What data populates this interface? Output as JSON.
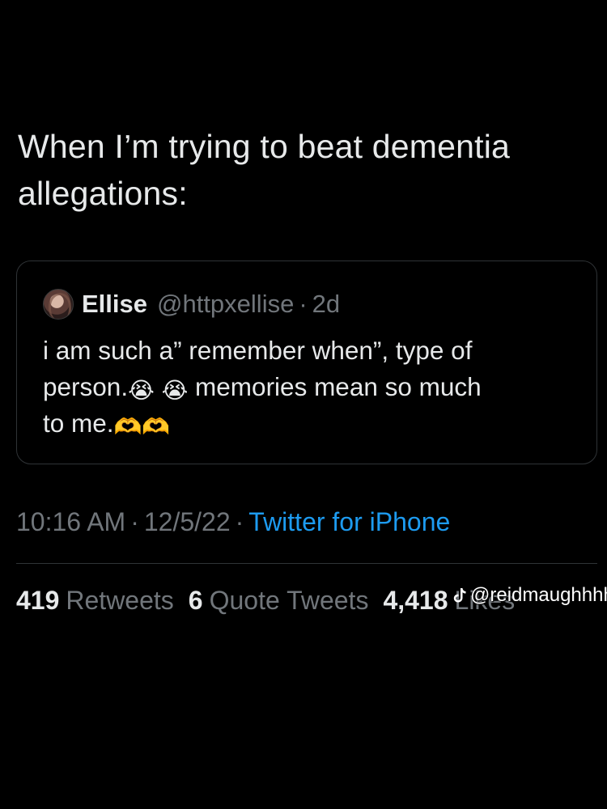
{
  "tweet": {
    "text_line1": "When I’m trying to beat dementia",
    "text_line2": "allegations:"
  },
  "quote": {
    "name": "Ellise",
    "handle": "@httpxellise",
    "separator": "·",
    "time": "2d",
    "body_line1": "i am such a” remember when”, type of",
    "body_line2a": "person.",
    "emoji_crying": "😭",
    "body_line2b": "memories mean so much",
    "body_line3": "to me.",
    "emoji_heart_hands": "🫶",
    "avatar_icon": "avatar-photo"
  },
  "meta": {
    "time": "10:16 AM",
    "dot": "·",
    "date": "12/5/22",
    "source": "Twitter for iPhone"
  },
  "stats": {
    "retweets_count": "419",
    "retweets_label": "Retweets",
    "quotes_count": "6",
    "quotes_label": "Quote Tweets",
    "likes_count": "4,418",
    "likes_label": "Likes"
  },
  "watermark": {
    "icon": "tiktok-icon",
    "text": "@reidmaughhhhh"
  },
  "colors": {
    "background": "#000000",
    "text": "#e7e9ea",
    "secondary": "#71767b",
    "link": "#1d9bf0",
    "border": "#2f3336"
  }
}
